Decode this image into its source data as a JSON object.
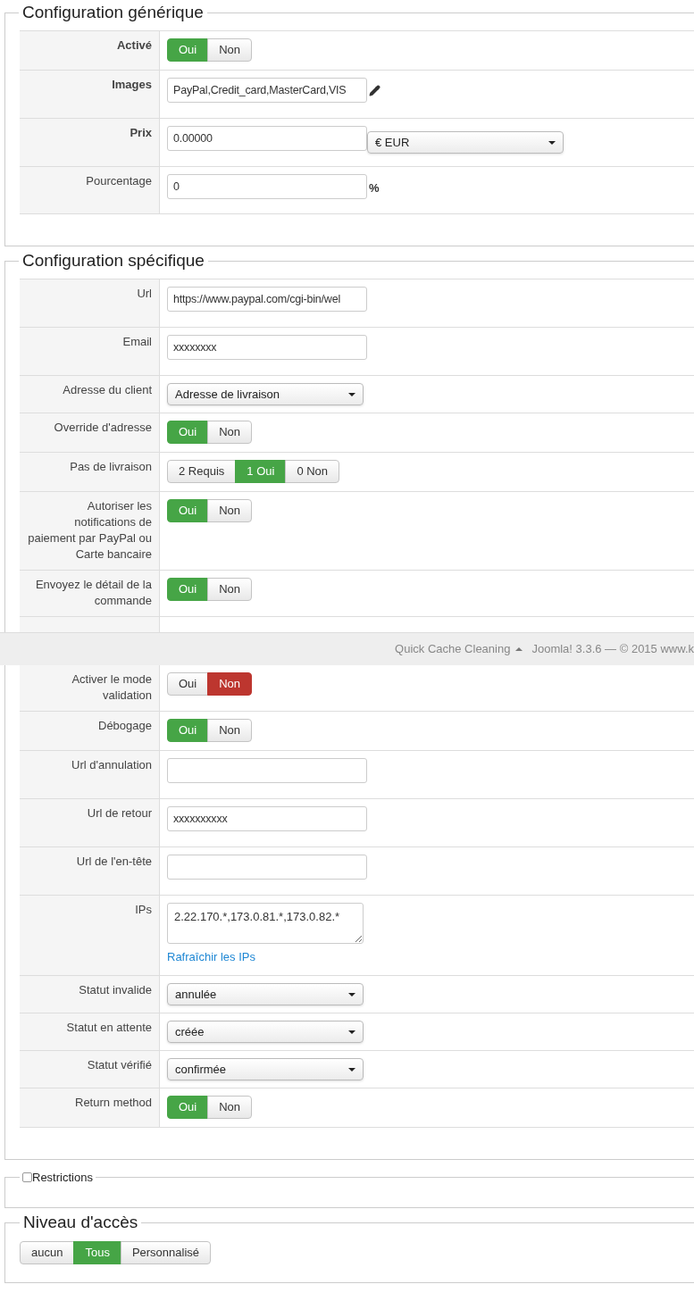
{
  "sections": [
    {
      "kind": "config",
      "title": "Configuration générique",
      "rows": [
        {
          "kind": "toggle",
          "label": "Activé",
          "bold": true,
          "options": [
            {
              "label": "Oui",
              "selected": true,
              "color": "#46a546"
            },
            {
              "label": "Non",
              "selected": false
            }
          ]
        },
        {
          "kind": "input_icon",
          "label": "Images",
          "bold": true,
          "value": "PayPal,Credit_card,MasterCard,VIS"
        },
        {
          "kind": "input_select",
          "label": "Prix",
          "bold": true,
          "value": "0.00000",
          "select": "€ EUR"
        },
        {
          "kind": "input_suffix",
          "label": "Pourcentage",
          "bold": false,
          "value": "0",
          "suffix": "%"
        }
      ]
    },
    {
      "kind": "config",
      "title": "Configuration spécifique",
      "rows": [
        {
          "kind": "input",
          "label": "Url",
          "bold": false,
          "value": "https://www.paypal.com/cgi-bin/wel"
        },
        {
          "kind": "input",
          "label": "Email",
          "bold": false,
          "value": "xxxxxxxx"
        },
        {
          "kind": "select",
          "label": "Adresse du client",
          "bold": false,
          "value": "Adresse de livraison"
        },
        {
          "kind": "toggle",
          "label": "Override d'adresse",
          "bold": false,
          "options": [
            {
              "label": "Oui",
              "selected": true,
              "color": "#46a546"
            },
            {
              "label": "Non",
              "selected": false
            }
          ]
        },
        {
          "kind": "toggle",
          "label": "Pas de livraison",
          "bold": false,
          "options": [
            {
              "label": "2 Requis",
              "selected": false
            },
            {
              "label": "1 Oui",
              "selected": true,
              "color": "#46a546"
            },
            {
              "label": "0 Non",
              "selected": false
            }
          ]
        },
        {
          "kind": "toggle",
          "label": "Autoriser les notifications de paiement par PayPal ou Carte bancaire",
          "bold": false,
          "options": [
            {
              "label": "Oui",
              "selected": true,
              "color": "#46a546"
            },
            {
              "label": "Non",
              "selected": false
            }
          ]
        },
        {
          "kind": "toggle",
          "label": "Envoyez le détail de la commande",
          "bold": false,
          "options": [
            {
              "label": "Oui",
              "selected": true,
              "color": "#46a546"
            },
            {
              "label": "Non",
              "selected": false
            }
          ]
        },
        {
          "kind": "footer_bar",
          "link": "Quick Cache Cleaning",
          "text": "Joomla! 3.3.6 — © 2015 www.k"
        },
        {
          "kind": "toggle",
          "label": "Activer le mode validation",
          "bold": false,
          "options": [
            {
              "label": "Oui",
              "selected": false
            },
            {
              "label": "Non",
              "selected": true,
              "color": "#bd362f"
            }
          ]
        },
        {
          "kind": "toggle",
          "label": "Débogage",
          "bold": false,
          "options": [
            {
              "label": "Oui",
              "selected": true,
              "color": "#46a546"
            },
            {
              "label": "Non",
              "selected": false
            }
          ]
        },
        {
          "kind": "input",
          "label": "Url d'annulation",
          "bold": false
        },
        {
          "kind": "input",
          "label": "Url de retour",
          "bold": false,
          "value": "xxxxxxxxxx"
        },
        {
          "kind": "input",
          "label": "Url de l'en-tête",
          "bold": false
        },
        {
          "kind": "textarea",
          "label": "IPs",
          "bold": false,
          "value": "2.22.170.*,173.0.81.*,173.0.82.*",
          "link": "Rafraîchir les IPs"
        },
        {
          "kind": "select",
          "label": "Statut invalide",
          "bold": false,
          "value": "annulée"
        },
        {
          "kind": "select",
          "label": "Statut en attente",
          "bold": false,
          "value": "créée"
        },
        {
          "kind": "select",
          "label": "Statut vérifié",
          "bold": false,
          "value": "confirmée"
        },
        {
          "kind": "toggle",
          "label": "Return method",
          "bold": false,
          "options": [
            {
              "label": "Oui",
              "selected": true,
              "color": "#46a546"
            },
            {
              "label": "Non",
              "selected": false
            }
          ]
        }
      ]
    },
    {
      "kind": "checkbox",
      "title": "Restrictions",
      "checked": false
    },
    {
      "kind": "buttons",
      "title": "Niveau d'accès",
      "options": [
        {
          "label": "aucun",
          "selected": false
        },
        {
          "label": "Tous",
          "selected": true,
          "color": "#46a546"
        },
        {
          "label": "Personnalisé",
          "selected": false
        }
      ]
    }
  ]
}
